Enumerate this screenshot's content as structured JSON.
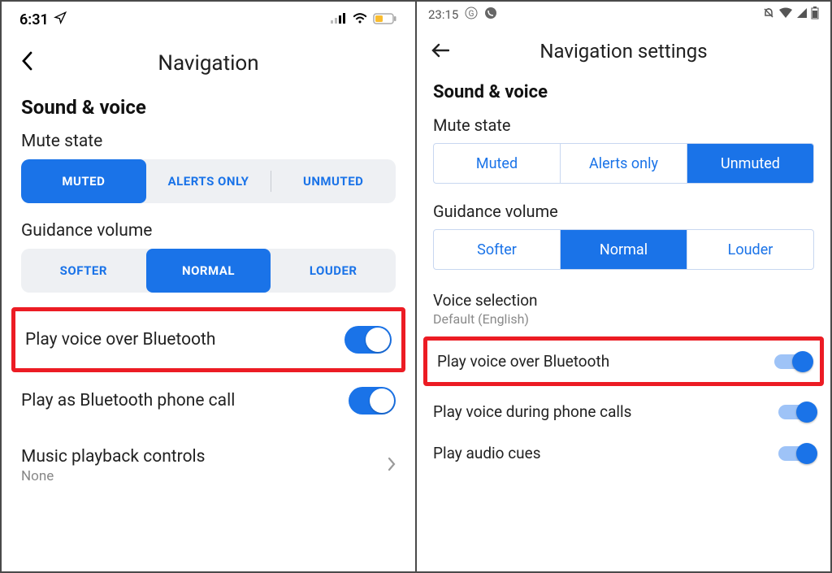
{
  "left": {
    "status": {
      "time": "6:31"
    },
    "header": {
      "title": "Navigation"
    },
    "section": "Sound & voice",
    "mute": {
      "label": "Mute state",
      "opts": [
        "MUTED",
        "ALERTS ONLY",
        "UNMUTED"
      ],
      "active": 0
    },
    "volume": {
      "label": "Guidance volume",
      "opts": [
        "SOFTER",
        "NORMAL",
        "LOUDER"
      ],
      "active": 1
    },
    "bt": {
      "label": "Play voice over Bluetooth",
      "on": true
    },
    "btcall": {
      "label": "Play as Bluetooth phone call",
      "on": true
    },
    "music": {
      "label": "Music playback controls",
      "value": "None"
    }
  },
  "right": {
    "status": {
      "time": "23:15"
    },
    "header": {
      "title": "Navigation settings"
    },
    "section": "Sound & voice",
    "mute": {
      "label": "Mute state",
      "opts": [
        "Muted",
        "Alerts only",
        "Unmuted"
      ],
      "active": 2
    },
    "volume": {
      "label": "Guidance volume",
      "opts": [
        "Softer",
        "Normal",
        "Louder"
      ],
      "active": 1
    },
    "voice": {
      "label": "Voice selection",
      "value": "Default (English)"
    },
    "bt": {
      "label": "Play voice over Bluetooth",
      "on": true
    },
    "calls": {
      "label": "Play voice during phone calls",
      "on": true
    },
    "cues": {
      "label": "Play audio cues",
      "on": true
    }
  }
}
